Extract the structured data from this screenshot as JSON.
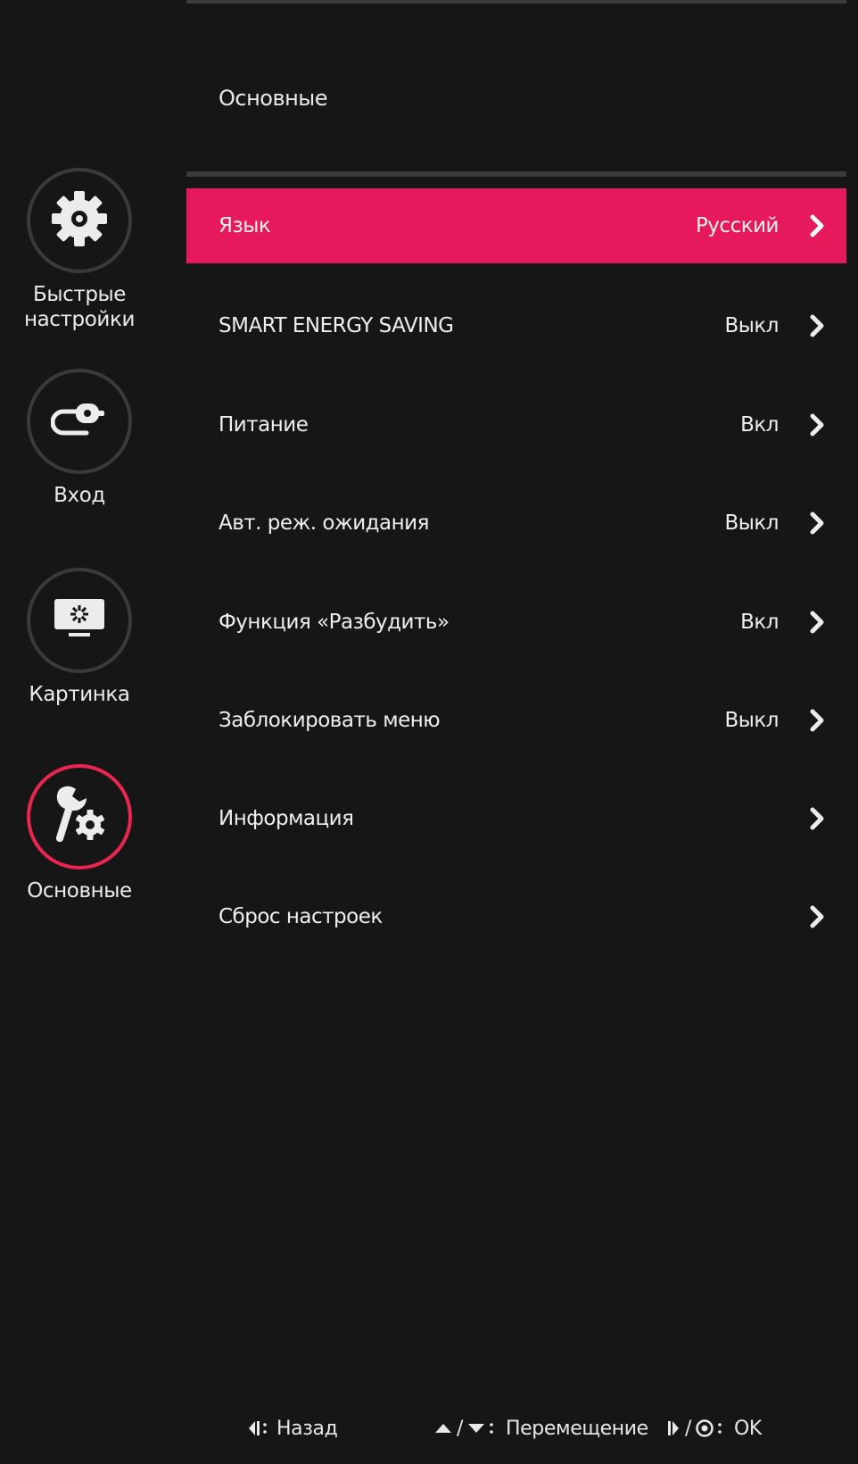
{
  "colors": {
    "background": "#161616",
    "accent": "#e5195c",
    "active_ring": "#e8264f",
    "ring": "#3a3a3a",
    "text": "#ececec"
  },
  "section_title": "Основные",
  "sidebar": {
    "items": [
      {
        "label": "Быстрые\nнастройки",
        "icon": "gear-icon",
        "active": false
      },
      {
        "label": "Вход",
        "icon": "input-cable-icon",
        "active": false
      },
      {
        "label": "Картинка",
        "icon": "monitor-picture-icon",
        "active": false
      },
      {
        "label": "Основные",
        "icon": "wrench-gear-icon",
        "active": true
      }
    ]
  },
  "menu": {
    "items": [
      {
        "label": "Язык",
        "value": "Русский",
        "selected": true
      },
      {
        "label": "SMART ENERGY SAVING",
        "value": "Выкл",
        "selected": false
      },
      {
        "label": "Питание",
        "value": "Вкл",
        "selected": false
      },
      {
        "label": "Авт. реж. ожидания",
        "value": "Выкл",
        "selected": false
      },
      {
        "label": "Функция «Разбудить»",
        "value": "Вкл",
        "selected": false
      },
      {
        "label": "Заблокировать меню",
        "value": "Выкл",
        "selected": false
      },
      {
        "label": "Информация",
        "value": "",
        "selected": false
      },
      {
        "label": "Сброс настроек",
        "value": "",
        "selected": false
      }
    ]
  },
  "footer": {
    "back_label": "Назад",
    "move_sep": "/",
    "move_label": "Перемещение",
    "ok_sep": "/",
    "ok_label": "OK"
  }
}
